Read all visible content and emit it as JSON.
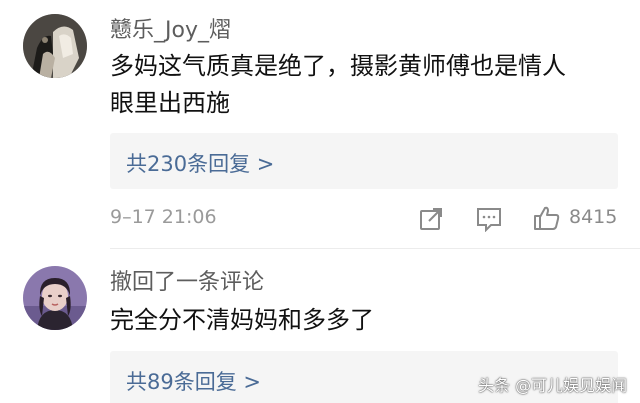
{
  "comments": [
    {
      "username": "戆乐_Joy_熠",
      "text_line1": "多妈这气质真是绝了，摄影黄师傅也是情人",
      "text_line2": "眼里出西施",
      "reply_label": "共230条回复 >",
      "timestamp": "9–17 21:06",
      "likes": "8415"
    },
    {
      "username": "撤回了一条评论",
      "text_line1": "完全分不清妈妈和多多了",
      "reply_label": "共89条回复 >"
    }
  ],
  "watermark": "头条 @可儿娱见娱闻",
  "icons": {
    "share": "share-icon",
    "comment": "comment-icon",
    "like": "thumbs-up-icon"
  },
  "colors": {
    "link": "#4a6b96",
    "text": "#111111",
    "meta": "#9a9a9a",
    "reply_bg": "#f5f5f5"
  }
}
